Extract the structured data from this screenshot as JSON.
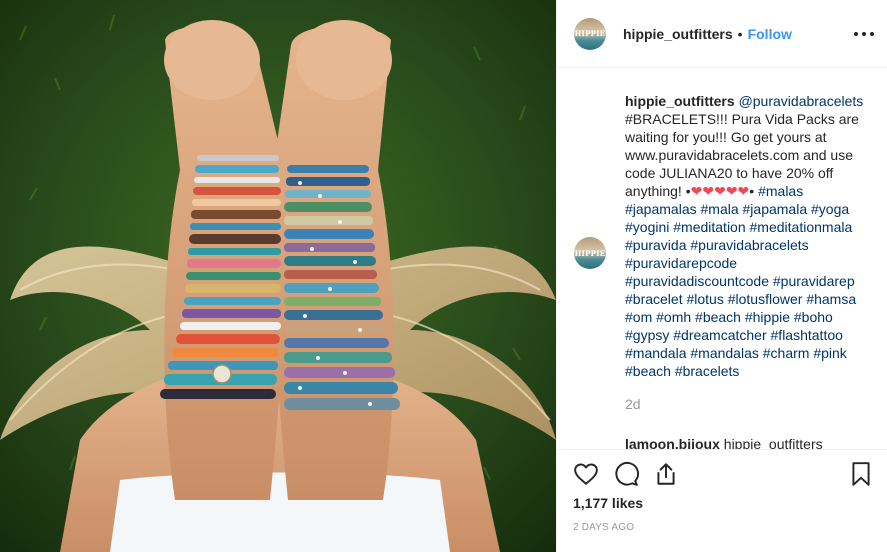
{
  "post": {
    "username": "hippie_outfitters",
    "separator": "•",
    "follow_label": "Follow",
    "avatar_text": "HIPPIE"
  },
  "caption": {
    "username": "hippie_outfitters",
    "mention": "@puravidabracelets",
    "part1": "#BRACELETS!!! Pura Vida Packs are waiting for you!!! Go get yours at www.puravidabracelets.com and use code JULIANA20 to have 20% off anything! •",
    "hearts": "❤❤❤❤❤",
    "bullet": "•",
    "hashtags": "#malas #japamalas #mala #japamala #yoga #yogini #meditation #meditationmala #puravida #puravidabracelets #puravidarepcode #puravidadiscountcode #puravidarep #bracelet #lotus #lotusflower #hamsa #om #omh #beach #hippie #boho #gypsy #dreamcatcher #flashtattoo #mandala #mandalas #charm #pink #beach #bracelets",
    "time": "2d"
  },
  "next_comment": {
    "username": "lamoon.bijoux",
    "text": "hippie_outfitters"
  },
  "actions": {
    "like_icon": "heart-outline-icon",
    "comment_icon": "speech-bubble-icon",
    "share_icon": "share-upload-icon",
    "save_icon": "bookmark-icon"
  },
  "likes_text": "1,177 likes",
  "posted_text": "2 DAYS AGO",
  "colors": {
    "link": "#003569",
    "follow": "#3897f0",
    "muted": "#999999",
    "heart": "#ed4956"
  }
}
